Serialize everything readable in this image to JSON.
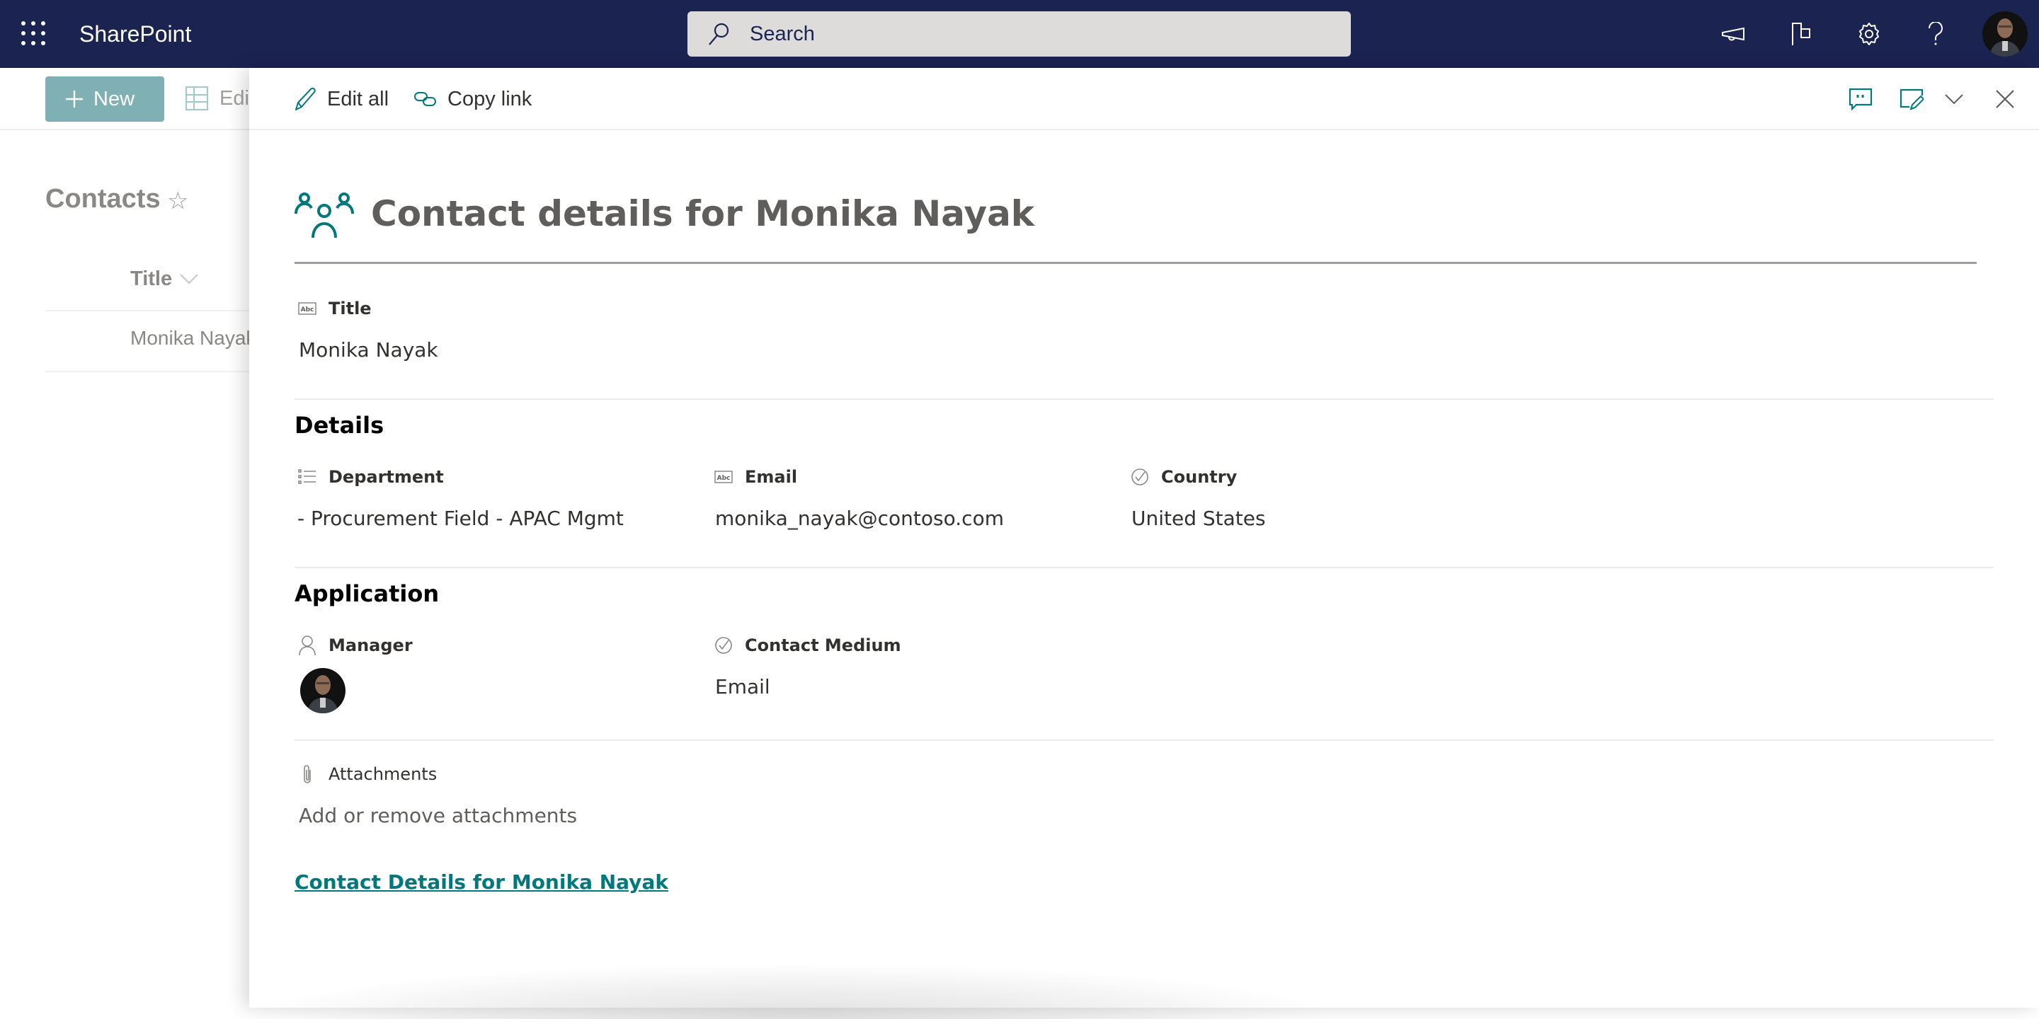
{
  "suite_header": {
    "app_name": "SharePoint",
    "search_placeholder": "Search",
    "icons": [
      "waffle-icon",
      "megaphone-icon",
      "flag-icon",
      "gear-icon",
      "help-icon",
      "avatar"
    ],
    "background_color": "#1b2351"
  },
  "background_list": {
    "command_bar": {
      "new_label": "New",
      "edit_grid_label": "Edi"
    },
    "list_title": "Contacts",
    "favorite_icon": "star-icon",
    "column_header": "Title",
    "rows": [
      {
        "title": "Monika Nayak"
      }
    ]
  },
  "panel": {
    "toolbar": {
      "edit_all_label": "Edit all",
      "copy_link_label": "Copy link",
      "right_icons": [
        "comments-icon",
        "edit-form-icon",
        "chevron-down-icon",
        "close-icon"
      ]
    },
    "form_title": "Contact details for Monika Nayak",
    "accent_color": "#03787c",
    "title_field": {
      "label": "Title",
      "value": "Monika Nayak"
    },
    "sections": [
      {
        "heading": "Details",
        "fields": [
          {
            "label": "Department",
            "value": "- Procurement Field - APAC Mgmt",
            "icon": "list-icon"
          },
          {
            "label": "Email",
            "value": "monika_nayak@contoso.com",
            "icon": "text-field-icon"
          },
          {
            "label": "Country",
            "value": "United States",
            "icon": "choice-icon"
          }
        ]
      },
      {
        "heading": "Application",
        "fields": [
          {
            "label": "Manager",
            "value": "",
            "icon": "person-icon"
          },
          {
            "label": "Contact Medium",
            "value": "Email",
            "icon": "choice-icon"
          }
        ]
      }
    ],
    "attachments": {
      "label": "Attachments",
      "placeholder": "Add or remove attachments"
    },
    "footer_link": "Contact Details for Monika Nayak"
  }
}
